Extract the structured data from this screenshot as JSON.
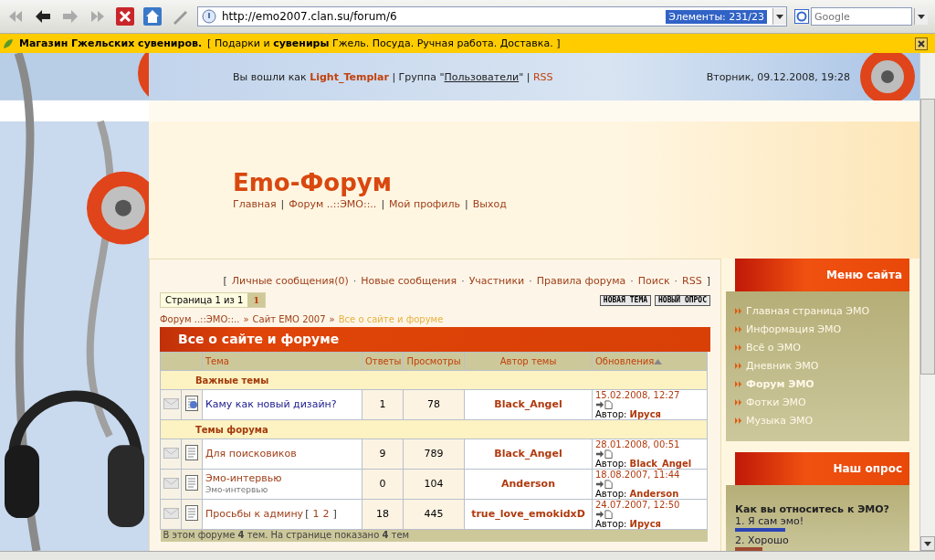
{
  "browser": {
    "url": "http://emo2007.clan.su/forum/6",
    "find_badge": "Элементы:  231/23",
    "search_placeholder": "Google"
  },
  "ad_bar": {
    "title": "Магазин Гжельских сувениров.",
    "text": "[ Подарки и **сувениры** Гжель. Посуда. Ручная работа. Доставка. ]"
  },
  "header": {
    "greeting": [
      {
        "kind": "plain",
        "text": "Вы вошли как "
      },
      {
        "kind": "user",
        "text": "Light_Templar"
      },
      {
        "kind": "plain",
        "text": " | Группа \""
      },
      {
        "kind": "group",
        "text": "Пользователи"
      },
      {
        "kind": "plain",
        "text": "\" | "
      },
      {
        "kind": "rss",
        "text": "RSS"
      }
    ],
    "date": "Вторник, 09.12.2008, 19:28"
  },
  "site": {
    "title": "Emo-Форум",
    "nav": [
      {
        "label": "Главная"
      },
      {
        "sep": "|",
        "label": "Форум ..::ЭМО::.."
      },
      {
        "sep": "|",
        "label": "Мой профиль"
      },
      {
        "sep": "|",
        "label": "Выход"
      }
    ]
  },
  "forum": {
    "links_open": "[",
    "links": [
      {
        "label": "Личные сообщения(0)"
      },
      {
        "sep": "·",
        "label": "Новые сообщения"
      },
      {
        "sep": "·",
        "label": "Участники"
      },
      {
        "sep": "·",
        "label": "Правила форума"
      },
      {
        "sep": "·",
        "label": "Поиск"
      },
      {
        "sep": "·",
        "label": "RSS"
      }
    ],
    "links_close": "]",
    "pager": {
      "label": "Страница 1 из 1",
      "pages": [
        {
          "label": "1",
          "selected": true
        }
      ]
    },
    "buttons": [
      "НОВАЯ ТЕМА",
      "НОВЫЙ ОПРОС"
    ],
    "breadcrumb": [
      {
        "label": "Форум ..::ЭМО::..",
        "current": false
      },
      {
        "sep": "»",
        "label": "Сайт EMO 2007",
        "current": false
      },
      {
        "sep": "»",
        "label": "Все о сайте и форуме",
        "current": true
      }
    ],
    "table": {
      "title": "Все о сайте и форуме",
      "columns": [
        {
          "label": "Тема",
          "sorted": false
        },
        {
          "label": "Ответы",
          "sorted": false
        },
        {
          "label": "Просмотры",
          "sorted": false
        },
        {
          "label": "Автор темы",
          "sorted": false
        },
        {
          "label": "Обновления",
          "sorted": true
        }
      ],
      "sections": [
        {
          "title": "Важные темы",
          "topics": [
            {
              "kind": "important",
              "title": "Каму как новый дизайн?",
              "replies": "1",
              "views": "78",
              "author": "Black_Angel",
              "updated": "15.02.2008, 12:27",
              "last_label": "Автор:",
              "last_author": "Ируся"
            }
          ]
        },
        {
          "title": "Темы форума",
          "topics": [
            {
              "kind": "normal",
              "title": "Для поисковиков",
              "replies": "9",
              "views": "789",
              "author": "Black_Angel",
              "updated": "28.01.2008, 00:51",
              "last_label": "Автор:",
              "last_author": "Black_Angel"
            },
            {
              "kind": "normal",
              "title": "Эмо-интервью",
              "subtitle": "Эмо-интервью",
              "replies": "0",
              "views": "104",
              "author": "Anderson",
              "updated": "18.08.2007, 11:44",
              "last_label": "Автор:",
              "last_author": "Anderson"
            },
            {
              "kind": "normal",
              "title": "Просьбы к админу",
              "pages_open": "[",
              "pages": [
                "1",
                "2"
              ],
              "pages_close": "]",
              "replies": "18",
              "views": "445",
              "author": "true_love_emokidxD",
              "updated": "24.07.2007, 12:50",
              "last_label": "Автор:",
              "last_author": "Ируся"
            }
          ]
        }
      ],
      "footer": "В этом форуме **4** тем. На странице показано **4** тем"
    }
  },
  "sidebar": {
    "menu": {
      "title": "Меню сайта",
      "items": [
        {
          "label": "Главная страница ЭМО",
          "selected": false
        },
        {
          "label": "Информация ЭМО",
          "selected": false
        },
        {
          "label": "Всё о ЭМО",
          "selected": false
        },
        {
          "label": "Дневник ЭМО",
          "selected": false
        },
        {
          "label": "Форум ЭМО",
          "selected": true
        },
        {
          "label": "Фотки ЭМО",
          "selected": false
        },
        {
          "label": "Музыка ЭМО",
          "selected": false
        }
      ]
    },
    "poll": {
      "title": "Наш опрос",
      "question": "Как вы относитесь к ЭМО?",
      "options": [
        {
          "label": "1. Я сам эмо!",
          "color": "#2a44b8"
        },
        {
          "label": "2. Хорошо",
          "color": "#a04a30"
        }
      ]
    }
  }
}
